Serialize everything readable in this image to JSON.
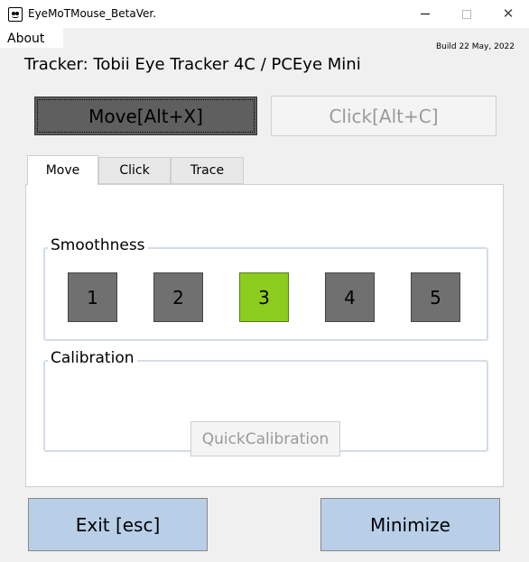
{
  "window": {
    "title": "EyeMoTMouse_BetaVer."
  },
  "menu": {
    "about": "About"
  },
  "build": "Build 22 May, 2022",
  "tracker": "Tracker: Tobii Eye Tracker 4C / PCEye Mini",
  "mode_buttons": {
    "move": "Move[Alt+X]",
    "click": "Click[Alt+C]"
  },
  "tabs": [
    {
      "label": "Move",
      "active": true
    },
    {
      "label": "Click",
      "active": false
    },
    {
      "label": "Trace",
      "active": false
    }
  ],
  "smoothness": {
    "label": "Smoothness",
    "levels": [
      "1",
      "2",
      "3",
      "4",
      "5"
    ],
    "selected": "3",
    "selected_color": "#8ccc1c"
  },
  "calibration": {
    "label": "Calibration",
    "quick_button": "QuickCalibration"
  },
  "bottom": {
    "exit": "Exit [esc]",
    "minimize": "Minimize"
  },
  "colors": {
    "bottom_button": "#b9cfe8",
    "level_button": "#707070"
  }
}
